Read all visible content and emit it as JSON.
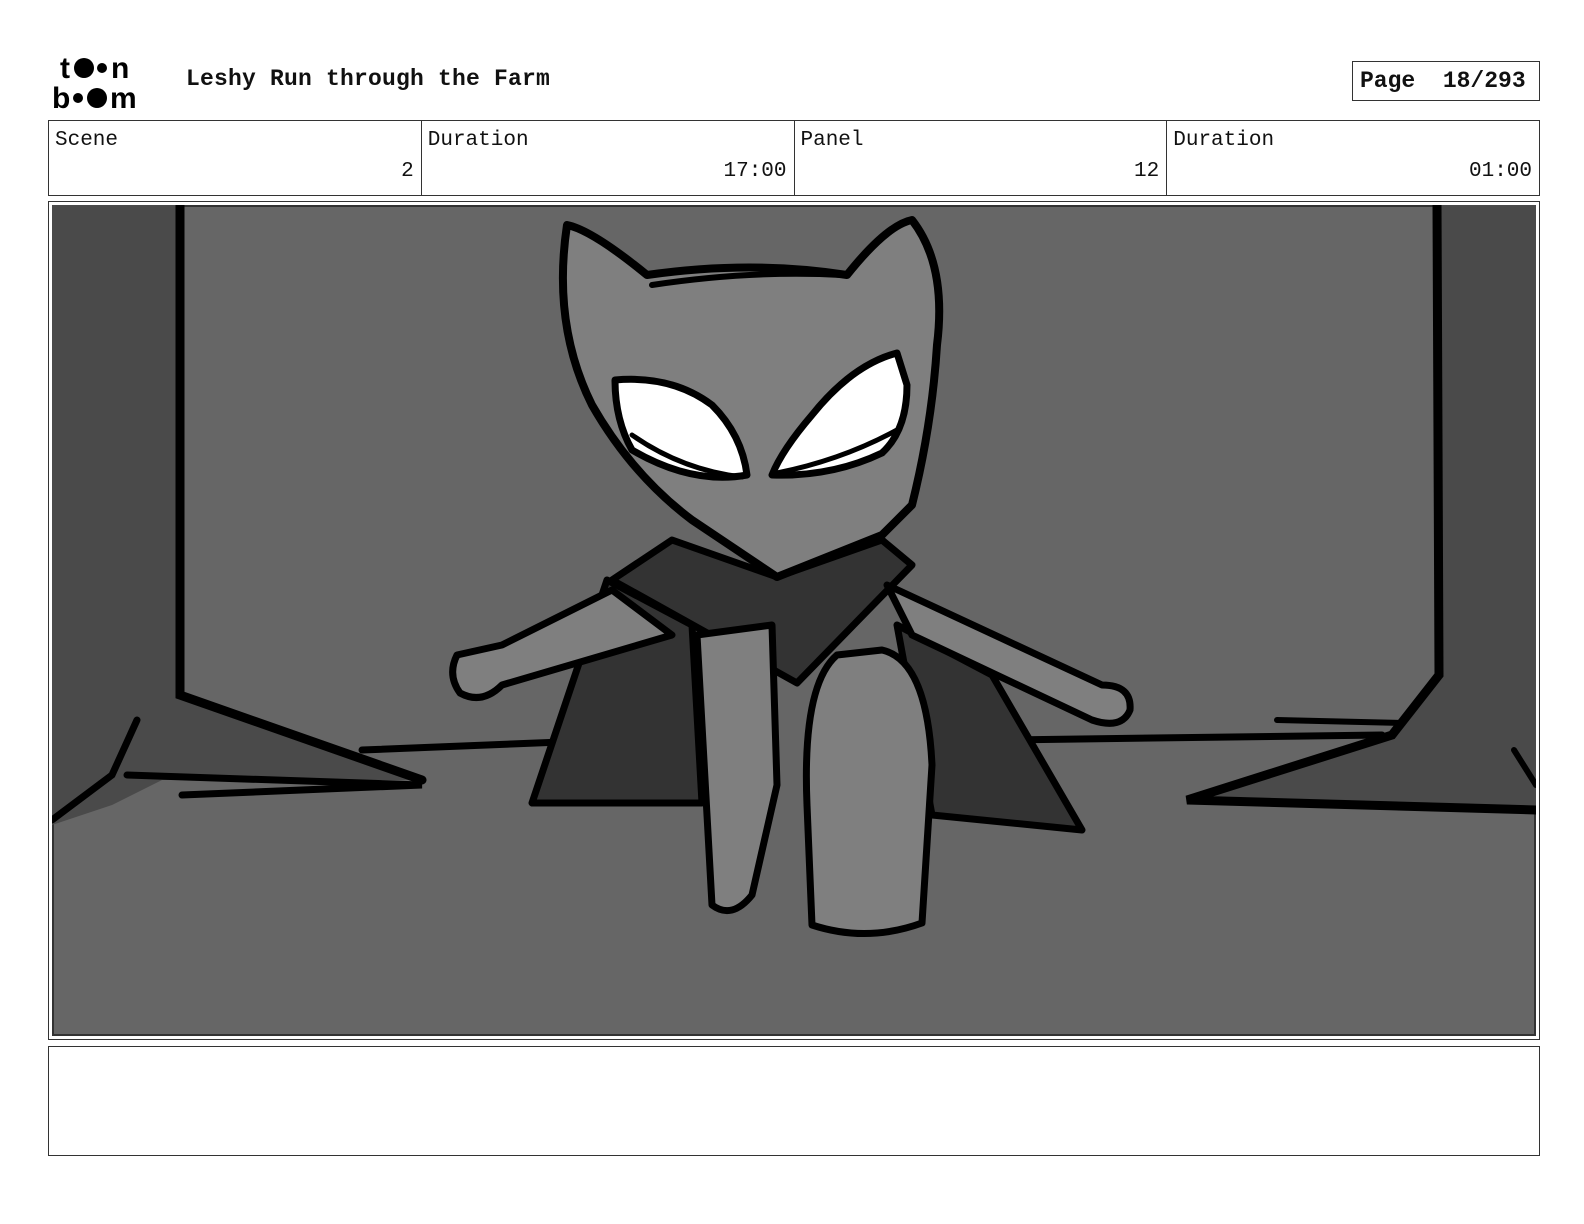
{
  "header": {
    "logo_text": "toon boom",
    "title": "Leshy Run through the Farm",
    "page_label": "Page",
    "page_number": "18/293"
  },
  "info": [
    {
      "label": "Scene",
      "value": "2"
    },
    {
      "label": "Duration",
      "value": "17:00"
    },
    {
      "label": "Panel",
      "value": "12"
    },
    {
      "label": "Duration",
      "value": "01:00"
    }
  ],
  "panel": {
    "description": "",
    "colors": {
      "background": "#666666",
      "trunk": "#4a4a4a",
      "body": "#7f7f7f",
      "cape": "#333333",
      "eyes": "#ffffff"
    }
  },
  "notes": ""
}
